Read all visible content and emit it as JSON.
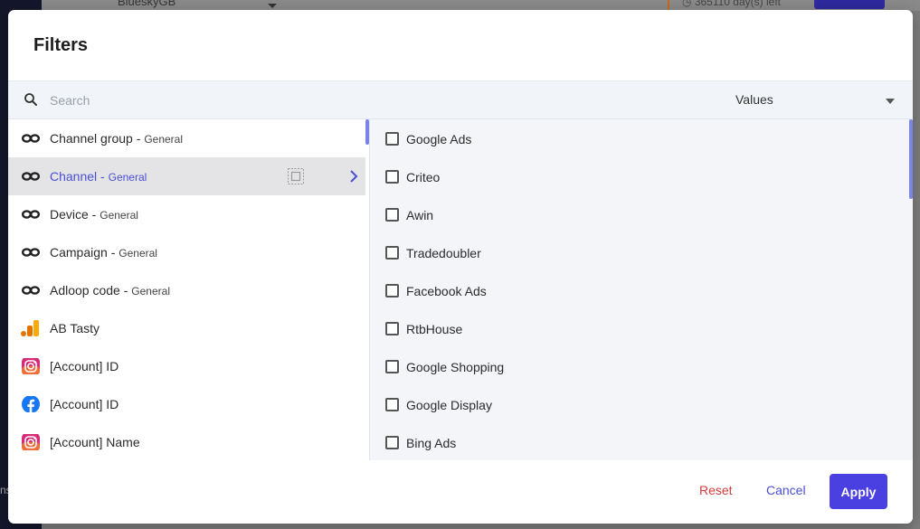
{
  "background": {
    "workspace_name": "BlueskyGB",
    "days_left": "365110 day(s) left",
    "left_edge_text": "ns"
  },
  "modal": {
    "title": "Filters",
    "search": {
      "placeholder": "Search",
      "value": ""
    },
    "values_select": {
      "selected": "Values"
    },
    "dimensions": [
      {
        "label": "Channel group",
        "sub": "General",
        "icon": "infinity-icon",
        "active": false
      },
      {
        "label": "Channel",
        "sub": "General",
        "icon": "infinity-icon",
        "active": true
      },
      {
        "label": "Device",
        "sub": "General",
        "icon": "infinity-icon",
        "active": false
      },
      {
        "label": "Campaign",
        "sub": "General",
        "icon": "infinity-icon",
        "active": false
      },
      {
        "label": "Adloop code",
        "sub": "General",
        "icon": "infinity-icon",
        "active": false
      },
      {
        "label": "AB Tasty",
        "sub": "",
        "icon": "google-analytics-icon",
        "active": false
      },
      {
        "label": "[Account] ID",
        "sub": "",
        "icon": "instagram-icon",
        "active": false
      },
      {
        "label": "[Account] ID",
        "sub": "",
        "icon": "facebook-icon",
        "active": false
      },
      {
        "label": "[Account] Name",
        "sub": "",
        "icon": "instagram-icon",
        "active": false
      }
    ],
    "sub_separator": " - ",
    "values": [
      {
        "label": "Google Ads",
        "checked": false
      },
      {
        "label": "Criteo",
        "checked": false
      },
      {
        "label": "Awin",
        "checked": false
      },
      {
        "label": "Tradedoubler",
        "checked": false
      },
      {
        "label": "Facebook Ads",
        "checked": false
      },
      {
        "label": "RtbHouse",
        "checked": false
      },
      {
        "label": "Google Shopping",
        "checked": false
      },
      {
        "label": "Google Display",
        "checked": false
      },
      {
        "label": "Bing Ads",
        "checked": false
      }
    ],
    "footer": {
      "reset_label": "Reset",
      "cancel_label": "Cancel",
      "apply_label": "Apply"
    }
  },
  "colors": {
    "accent": "#4a3fe0",
    "active_text": "#4a4fd6",
    "reset": "#d23c3c",
    "active_row": "#e4e4e6",
    "values_pane": "#f3f5f9"
  }
}
